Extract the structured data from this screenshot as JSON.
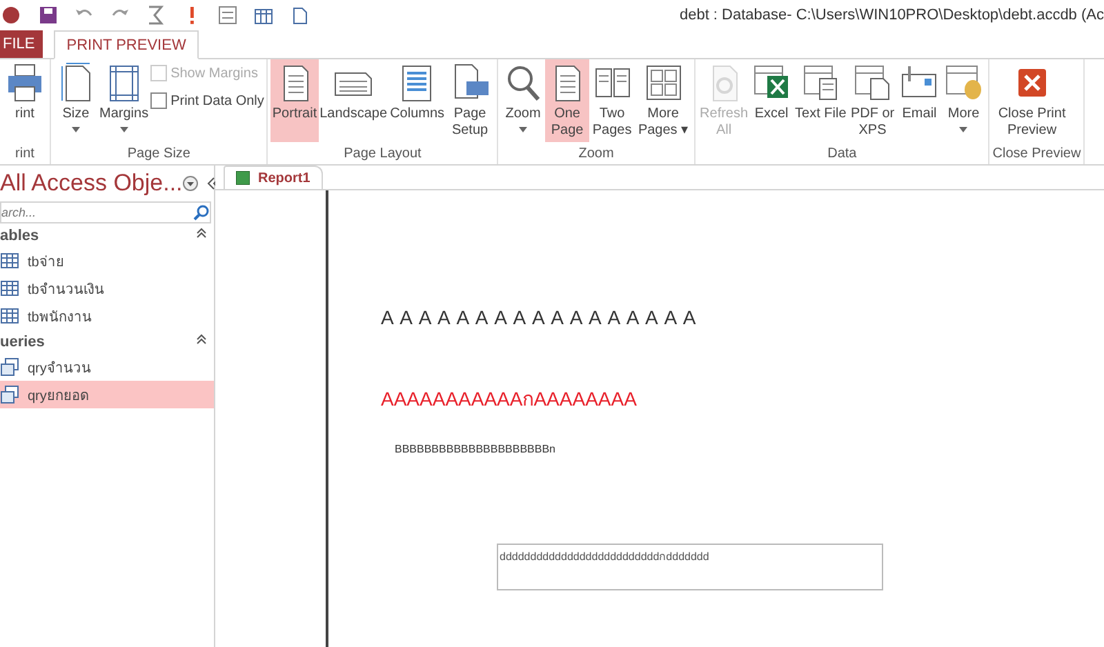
{
  "window": {
    "title": "debt : Database- C:\\Users\\WIN10PRO\\Desktop\\debt.accdb (Ac"
  },
  "tabs": [
    {
      "label": "FILE",
      "kind": "file",
      "selected": false
    },
    {
      "label": "PRINT PREVIEW",
      "kind": "tab",
      "selected": true
    }
  ],
  "ribbon": [
    {
      "label": "rint",
      "items": [
        {
          "kind": "button",
          "label": "rint",
          "selected": false,
          "disabled": false
        }
      ]
    },
    {
      "label": "Page Size",
      "items": [
        {
          "kind": "button",
          "label": "Size",
          "selected": false,
          "disabled": false,
          "dropdown": true
        },
        {
          "kind": "button",
          "label": "Margins",
          "selected": false,
          "disabled": false,
          "dropdown": true
        },
        {
          "kind": "checks",
          "checks": [
            {
              "label": "Show Margins",
              "checked": false,
              "disabled": true
            },
            {
              "label": "Print Data Only",
              "checked": false,
              "disabled": false
            }
          ]
        }
      ]
    },
    {
      "label": "Page Layout",
      "items": [
        {
          "kind": "button",
          "label": "Portrait",
          "selected": true,
          "disabled": false
        },
        {
          "kind": "button",
          "label": "Landscape",
          "selected": false,
          "disabled": false
        },
        {
          "kind": "button",
          "label": "Columns",
          "selected": false,
          "disabled": false
        },
        {
          "kind": "button",
          "label": "Page Setup",
          "selected": false,
          "disabled": false
        }
      ]
    },
    {
      "label": "Zoom",
      "items": [
        {
          "kind": "button",
          "label": "Zoom",
          "selected": false,
          "disabled": false,
          "dropdown": true
        },
        {
          "kind": "button",
          "label": "One Page",
          "selected": true,
          "disabled": false
        },
        {
          "kind": "button",
          "label": "Two Pages",
          "selected": false,
          "disabled": false
        },
        {
          "kind": "button",
          "label": "More Pages ▾",
          "selected": false,
          "disabled": false
        }
      ]
    },
    {
      "label": "Data",
      "items": [
        {
          "kind": "button",
          "label": "Refresh All",
          "selected": false,
          "disabled": true
        },
        {
          "kind": "button",
          "label": "Excel",
          "selected": false,
          "disabled": false
        },
        {
          "kind": "button",
          "label": "Text File",
          "selected": false,
          "disabled": false
        },
        {
          "kind": "button",
          "label": "PDF or XPS",
          "selected": false,
          "disabled": false
        },
        {
          "kind": "button",
          "label": "Email",
          "selected": false,
          "disabled": false
        },
        {
          "kind": "button",
          "label": "More",
          "selected": false,
          "disabled": false,
          "dropdown": true
        }
      ]
    },
    {
      "label": "Close Preview",
      "items": [
        {
          "kind": "button",
          "label": "Close Print Preview",
          "selected": false,
          "disabled": false
        }
      ]
    }
  ],
  "nav": {
    "title": "All Access Obje...",
    "search": {
      "placeholder": "arch..."
    },
    "groups": [
      {
        "label": "ables",
        "items": [
          {
            "label": "tbจ่าย",
            "kind": "table",
            "selected": false
          },
          {
            "label": "tbจำนวนเงิน",
            "kind": "table",
            "selected": false
          },
          {
            "label": "tbพนักงาน",
            "kind": "table",
            "selected": false
          }
        ]
      },
      {
        "label": "ueries",
        "items": [
          {
            "label": "qryจำนวน",
            "kind": "query",
            "selected": false
          },
          {
            "label": "qryยกยอด",
            "kind": "query",
            "selected": true
          }
        ]
      }
    ]
  },
  "document_tab": {
    "label": "Report1"
  },
  "report": {
    "heading": "A A A A A A A A A A A A A A A A A",
    "red_line": "AAAAAAAAAAAกAAAAAAAA",
    "small_line": "BBBBBBBBBBBBBBBBBBBBBn",
    "box_text": "ddddddddddddddddddddddddddกddddddd"
  }
}
